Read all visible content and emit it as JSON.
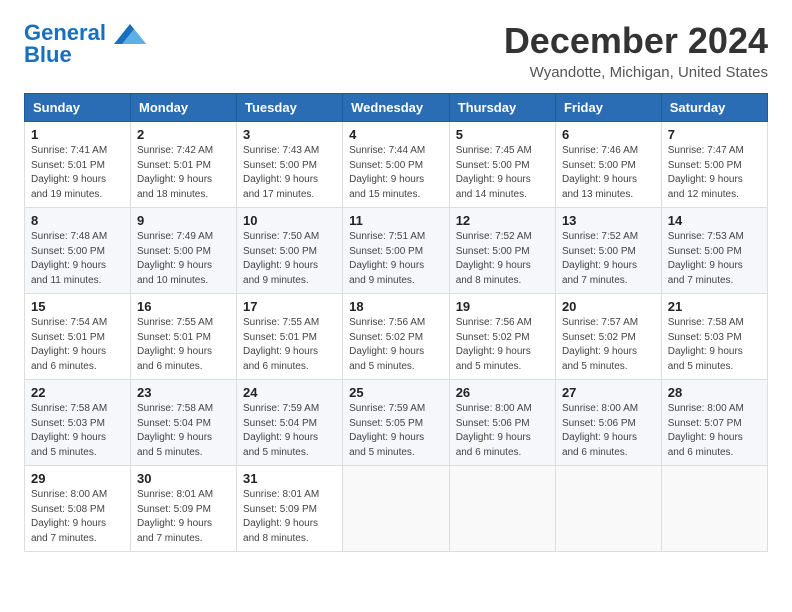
{
  "logo": {
    "line1": "General",
    "line2": "Blue",
    "tagline": ""
  },
  "header": {
    "month": "December 2024",
    "location": "Wyandotte, Michigan, United States"
  },
  "weekdays": [
    "Sunday",
    "Monday",
    "Tuesday",
    "Wednesday",
    "Thursday",
    "Friday",
    "Saturday"
  ],
  "weeks": [
    [
      {
        "day": "1",
        "info": "Sunrise: 7:41 AM\nSunset: 5:01 PM\nDaylight: 9 hours\nand 19 minutes."
      },
      {
        "day": "2",
        "info": "Sunrise: 7:42 AM\nSunset: 5:01 PM\nDaylight: 9 hours\nand 18 minutes."
      },
      {
        "day": "3",
        "info": "Sunrise: 7:43 AM\nSunset: 5:00 PM\nDaylight: 9 hours\nand 17 minutes."
      },
      {
        "day": "4",
        "info": "Sunrise: 7:44 AM\nSunset: 5:00 PM\nDaylight: 9 hours\nand 15 minutes."
      },
      {
        "day": "5",
        "info": "Sunrise: 7:45 AM\nSunset: 5:00 PM\nDaylight: 9 hours\nand 14 minutes."
      },
      {
        "day": "6",
        "info": "Sunrise: 7:46 AM\nSunset: 5:00 PM\nDaylight: 9 hours\nand 13 minutes."
      },
      {
        "day": "7",
        "info": "Sunrise: 7:47 AM\nSunset: 5:00 PM\nDaylight: 9 hours\nand 12 minutes."
      }
    ],
    [
      {
        "day": "8",
        "info": "Sunrise: 7:48 AM\nSunset: 5:00 PM\nDaylight: 9 hours\nand 11 minutes."
      },
      {
        "day": "9",
        "info": "Sunrise: 7:49 AM\nSunset: 5:00 PM\nDaylight: 9 hours\nand 10 minutes."
      },
      {
        "day": "10",
        "info": "Sunrise: 7:50 AM\nSunset: 5:00 PM\nDaylight: 9 hours\nand 9 minutes."
      },
      {
        "day": "11",
        "info": "Sunrise: 7:51 AM\nSunset: 5:00 PM\nDaylight: 9 hours\nand 9 minutes."
      },
      {
        "day": "12",
        "info": "Sunrise: 7:52 AM\nSunset: 5:00 PM\nDaylight: 9 hours\nand 8 minutes."
      },
      {
        "day": "13",
        "info": "Sunrise: 7:52 AM\nSunset: 5:00 PM\nDaylight: 9 hours\nand 7 minutes."
      },
      {
        "day": "14",
        "info": "Sunrise: 7:53 AM\nSunset: 5:00 PM\nDaylight: 9 hours\nand 7 minutes."
      }
    ],
    [
      {
        "day": "15",
        "info": "Sunrise: 7:54 AM\nSunset: 5:01 PM\nDaylight: 9 hours\nand 6 minutes."
      },
      {
        "day": "16",
        "info": "Sunrise: 7:55 AM\nSunset: 5:01 PM\nDaylight: 9 hours\nand 6 minutes."
      },
      {
        "day": "17",
        "info": "Sunrise: 7:55 AM\nSunset: 5:01 PM\nDaylight: 9 hours\nand 6 minutes."
      },
      {
        "day": "18",
        "info": "Sunrise: 7:56 AM\nSunset: 5:02 PM\nDaylight: 9 hours\nand 5 minutes."
      },
      {
        "day": "19",
        "info": "Sunrise: 7:56 AM\nSunset: 5:02 PM\nDaylight: 9 hours\nand 5 minutes."
      },
      {
        "day": "20",
        "info": "Sunrise: 7:57 AM\nSunset: 5:02 PM\nDaylight: 9 hours\nand 5 minutes."
      },
      {
        "day": "21",
        "info": "Sunrise: 7:58 AM\nSunset: 5:03 PM\nDaylight: 9 hours\nand 5 minutes."
      }
    ],
    [
      {
        "day": "22",
        "info": "Sunrise: 7:58 AM\nSunset: 5:03 PM\nDaylight: 9 hours\nand 5 minutes."
      },
      {
        "day": "23",
        "info": "Sunrise: 7:58 AM\nSunset: 5:04 PM\nDaylight: 9 hours\nand 5 minutes."
      },
      {
        "day": "24",
        "info": "Sunrise: 7:59 AM\nSunset: 5:04 PM\nDaylight: 9 hours\nand 5 minutes."
      },
      {
        "day": "25",
        "info": "Sunrise: 7:59 AM\nSunset: 5:05 PM\nDaylight: 9 hours\nand 5 minutes."
      },
      {
        "day": "26",
        "info": "Sunrise: 8:00 AM\nSunset: 5:06 PM\nDaylight: 9 hours\nand 6 minutes."
      },
      {
        "day": "27",
        "info": "Sunrise: 8:00 AM\nSunset: 5:06 PM\nDaylight: 9 hours\nand 6 minutes."
      },
      {
        "day": "28",
        "info": "Sunrise: 8:00 AM\nSunset: 5:07 PM\nDaylight: 9 hours\nand 6 minutes."
      }
    ],
    [
      {
        "day": "29",
        "info": "Sunrise: 8:00 AM\nSunset: 5:08 PM\nDaylight: 9 hours\nand 7 minutes."
      },
      {
        "day": "30",
        "info": "Sunrise: 8:01 AM\nSunset: 5:09 PM\nDaylight: 9 hours\nand 7 minutes."
      },
      {
        "day": "31",
        "info": "Sunrise: 8:01 AM\nSunset: 5:09 PM\nDaylight: 9 hours\nand 8 minutes."
      },
      {
        "day": "",
        "info": ""
      },
      {
        "day": "",
        "info": ""
      },
      {
        "day": "",
        "info": ""
      },
      {
        "day": "",
        "info": ""
      }
    ]
  ]
}
